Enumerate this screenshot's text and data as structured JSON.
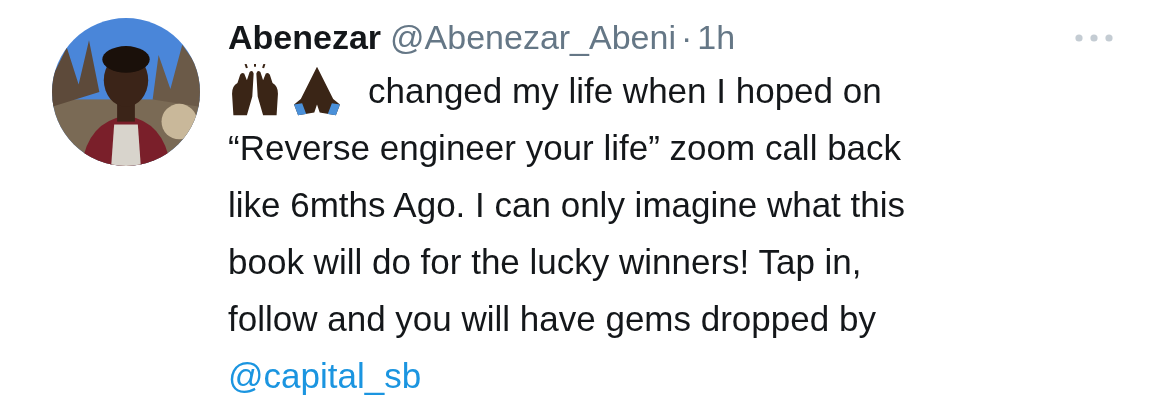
{
  "author": {
    "name": "Abenezar",
    "handle": "@Abenezar_Abeni",
    "separator": "·",
    "time": "1h"
  },
  "tweet": {
    "lines": [
      "changed my life when I hoped on",
      "“Reverse engineer your life” zoom call back",
      "like 6mths Ago. I can only imagine what this",
      "book will do for the lucky winners! Tap in,",
      "follow and you will have gems dropped by"
    ],
    "mention": "@capital_sb"
  }
}
